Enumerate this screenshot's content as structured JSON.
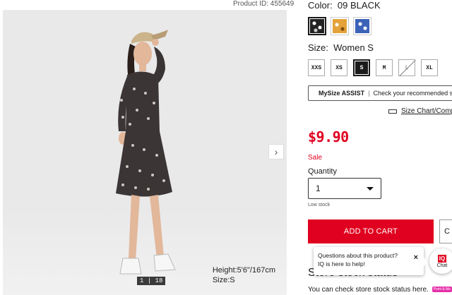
{
  "header": {
    "product_id": "Product ID: 455649"
  },
  "gallery": {
    "counter": "1 | 18",
    "model_height": "Height:5'6\"/167cm",
    "model_size": "Size:S",
    "next_icon": "chevron-right-icon"
  },
  "color": {
    "label": "Color:",
    "value": "09 BLACK",
    "swatches": [
      "black-floral",
      "yellow-floral",
      "blue-floral"
    ]
  },
  "size": {
    "label": "Size:",
    "value": "Women S",
    "options": [
      "XXS",
      "XS",
      "S",
      "M",
      "L",
      "XL"
    ],
    "selected": "S",
    "unavailable": [
      "L"
    ]
  },
  "mysize": {
    "brand": "MySize ASSIST",
    "text": "Check your recommended size"
  },
  "size_chart": {
    "label": "Size Chart/Compare"
  },
  "price": {
    "value": "$9.90",
    "sale_label": "Sale"
  },
  "quantity": {
    "label": "Quantity",
    "value": "1",
    "stock_note": "Low stock"
  },
  "cart": {
    "add_label": "ADD TO CART",
    "secondary_label": "C"
  },
  "chat_tooltip": {
    "line1": "Questions about this product?",
    "line2": "IQ is here to help!",
    "close": "×"
  },
  "chat_button": {
    "badge": "IQ",
    "label": "Chat"
  },
  "store": {
    "title": "Store stock status",
    "text": "You can check store stock status here.",
    "badge": "Point & Me"
  },
  "colors": {
    "accent": "#e0001f",
    "text": "#1b1b1b",
    "badge": "#e62fa8"
  }
}
